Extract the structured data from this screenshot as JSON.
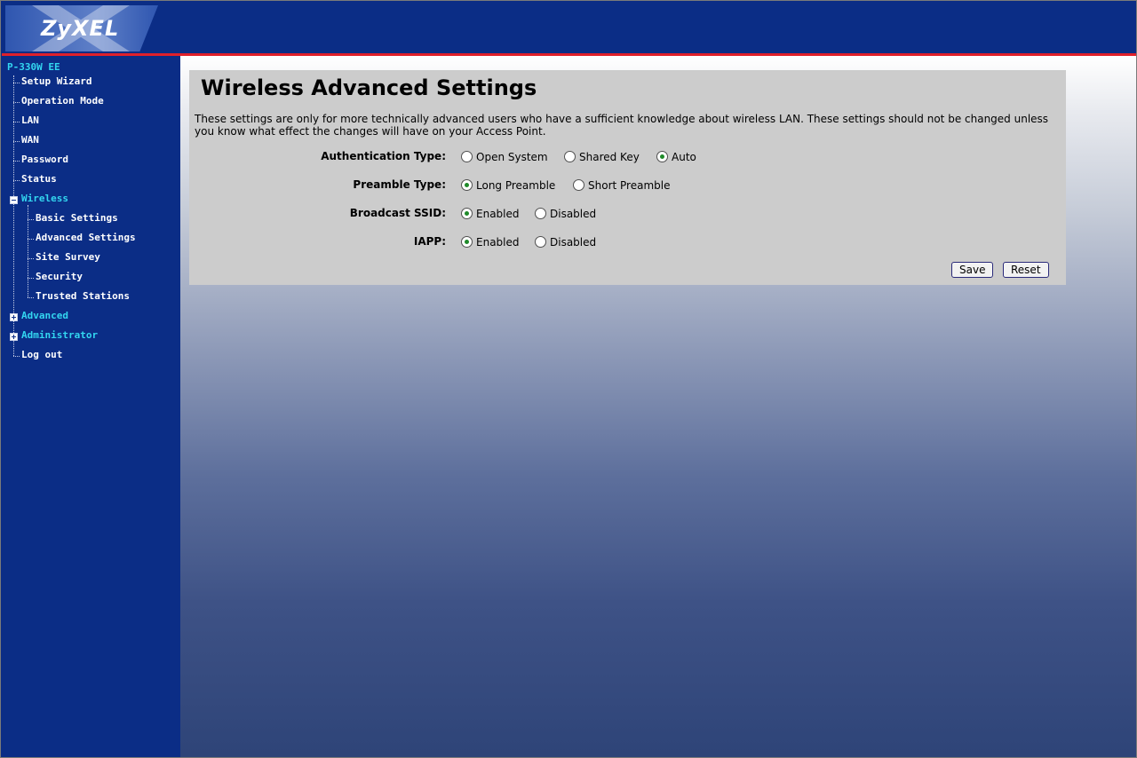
{
  "header": {
    "logo_text": "ZyXEL"
  },
  "sidebar": {
    "model": "P-330W EE",
    "items": [
      {
        "label": "Setup Wizard"
      },
      {
        "label": "Operation Mode"
      },
      {
        "label": "LAN"
      },
      {
        "label": "WAN"
      },
      {
        "label": "Password"
      },
      {
        "label": "Status"
      },
      {
        "label": "Wireless",
        "expanded": true
      },
      {
        "label": "Basic Settings"
      },
      {
        "label": "Advanced Settings"
      },
      {
        "label": "Site Survey"
      },
      {
        "label": "Security"
      },
      {
        "label": "Trusted Stations"
      },
      {
        "label": "Advanced",
        "expanded": false
      },
      {
        "label": "Administrator",
        "expanded": false
      },
      {
        "label": "Log out"
      }
    ]
  },
  "main": {
    "title": "Wireless Advanced Settings",
    "description": "These settings are only for more technically advanced users who have a sufficient knowledge about wireless LAN. These settings should not be changed unless you know what effect the changes will have on your Access Point.",
    "rows": [
      {
        "label": "Authentication Type:",
        "options": [
          {
            "label": "Open System",
            "checked": false
          },
          {
            "label": "Shared Key",
            "checked": false
          },
          {
            "label": "Auto",
            "checked": true
          }
        ]
      },
      {
        "label": "Preamble Type:",
        "options": [
          {
            "label": "Long Preamble",
            "checked": true
          },
          {
            "label": "Short Preamble",
            "checked": false
          }
        ]
      },
      {
        "label": "Broadcast SSID:",
        "options": [
          {
            "label": "Enabled",
            "checked": true
          },
          {
            "label": "Disabled",
            "checked": false
          }
        ]
      },
      {
        "label": "IAPP:",
        "options": [
          {
            "label": "Enabled",
            "checked": true
          },
          {
            "label": "Disabled",
            "checked": false
          }
        ]
      }
    ],
    "save_label": "Save",
    "reset_label": "Reset"
  },
  "colors": {
    "nav_background": "#0b2d86",
    "accent_red": "#e0202a",
    "nav_highlight": "#33d6f0",
    "panel_background": "#cccccc"
  }
}
